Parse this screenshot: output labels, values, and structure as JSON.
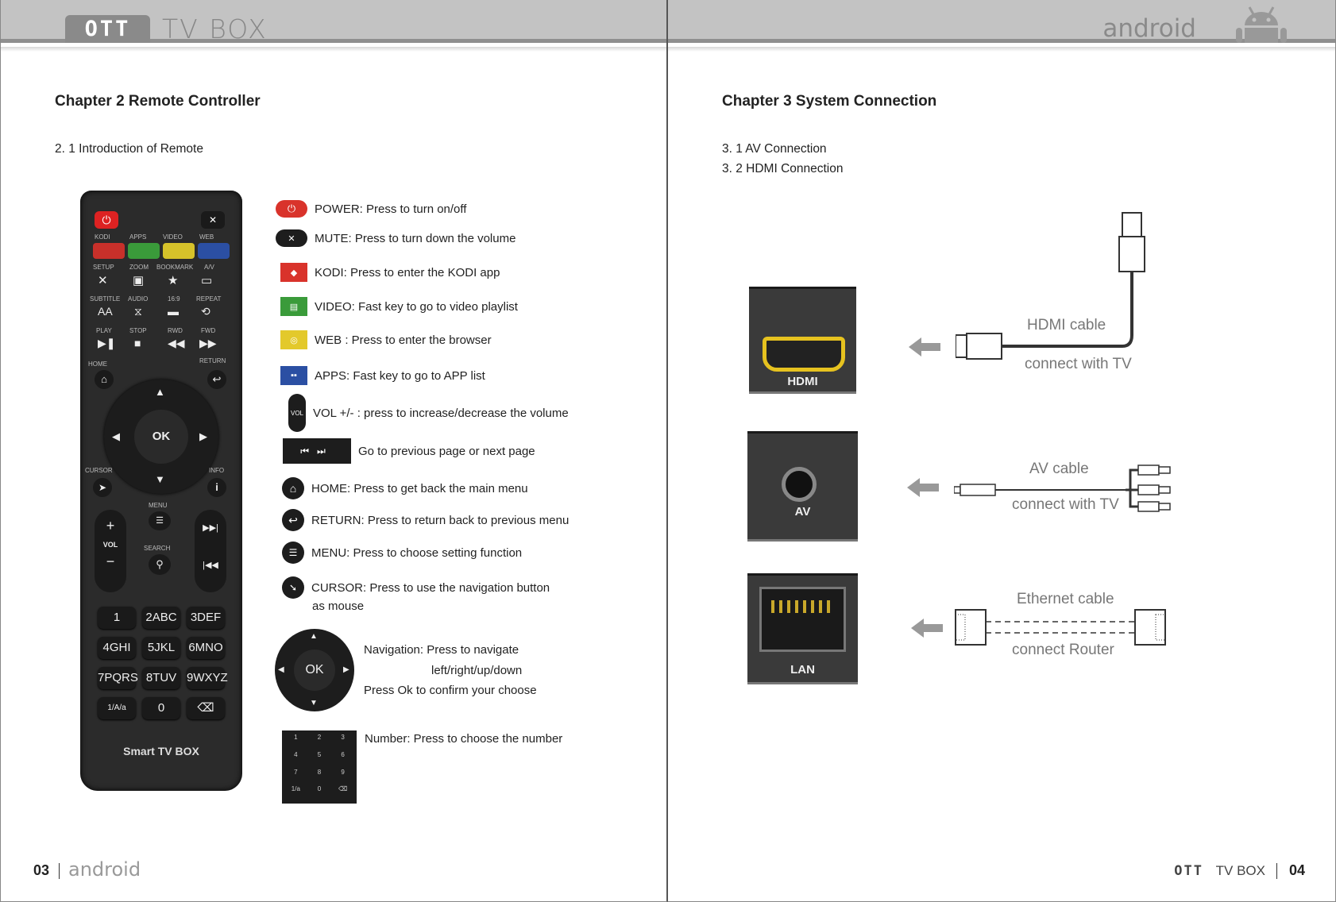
{
  "header": {
    "badge": "OTT",
    "title": "TV BOX",
    "brand": "android"
  },
  "left_page": {
    "chapter": "Chapter 2 Remote Controller",
    "section": "2. 1 Introduction of Remote",
    "remote": {
      "top_labels": [
        "KODI",
        "APPS",
        "VIDEO",
        "WEB"
      ],
      "row2_labels": [
        "SETUP",
        "ZOOM",
        "BOOKMARK",
        "A/V"
      ],
      "row3_labels": [
        "SUBTITLE",
        "AUDIO",
        "16:9",
        "REPEAT"
      ],
      "row4_labels": [
        "PLAY",
        "STOP",
        "RWD",
        "FWD"
      ],
      "home": "HOME",
      "return": "RETURN",
      "ok": "OK",
      "cursor": "CURSOR",
      "info": "INFO",
      "menu": "MENU",
      "search": "SEARCH",
      "vol": "VOL",
      "keys": [
        "1",
        "2ABC",
        "3DEF",
        "4GHI",
        "5JKL",
        "6MNO",
        "7PQRS",
        "8TUV",
        "9WXYZ",
        "1/A/a",
        "0",
        "⌫"
      ],
      "brand": "Smart TV BOX"
    },
    "legend": [
      {
        "text": "POWER: Press to turn on/off",
        "color": "#d9332b"
      },
      {
        "text": "MUTE: Press to turn down the volume",
        "color": "#1d1d1d"
      },
      {
        "text": "KODI: Press to enter the KODI app",
        "color": "#d9332b"
      },
      {
        "text": "VIDEO: Fast key to go to video playlist",
        "color": "#3a9b3a"
      },
      {
        "text": "WEB : Press to enter the browser",
        "color": "#e3c92b"
      },
      {
        "text": "APPS: Fast key to go to APP list",
        "color": "#2b4fa3"
      },
      {
        "text": "VOL +/-  : press to increase/decrease the volume",
        "color": "#1d1d1d"
      },
      {
        "text": "Go to previous page or next page",
        "color": "#1d1d1d"
      },
      {
        "text": "HOME: Press to get back the main menu",
        "color": "#1d1d1d"
      },
      {
        "text": "RETURN: Press to return back to previous menu",
        "color": "#1d1d1d"
      },
      {
        "text": "MENU: Press to choose setting function",
        "color": "#1d1d1d"
      },
      {
        "text": "CURSOR: Press to use the navigation button",
        "color": "#1d1d1d"
      },
      {
        "text": "as mouse",
        "color": ""
      }
    ],
    "navigation": {
      "ok": "OK",
      "line1": "Navigation: Press to navigate",
      "line2": "left/right/up/down",
      "line3": "Press Ok to confirm your choose"
    },
    "number_text": "Number: Press to choose the number",
    "numpad": [
      "1",
      "2",
      "3",
      "4",
      "5",
      "6",
      "7",
      "8",
      "9",
      "1/a",
      "0",
      "⌫"
    ],
    "footer_num": "03",
    "footer_brand": "android"
  },
  "right_page": {
    "chapter": "Chapter 3 System Connection",
    "sections": [
      "3. 1 AV Connection",
      "3. 2 HDMI Connection"
    ],
    "hdmi": {
      "port": "HDMI",
      "cable": "HDMI cable",
      "connect": "connect with TV"
    },
    "av": {
      "port": "AV",
      "cable": "AV cable",
      "connect": "connect with TV"
    },
    "lan": {
      "port": "LAN",
      "cable": "Ethernet cable",
      "connect": "connect Router"
    },
    "footer_badge": "OTT",
    "footer_title": "TV BOX",
    "footer_num": "04"
  }
}
